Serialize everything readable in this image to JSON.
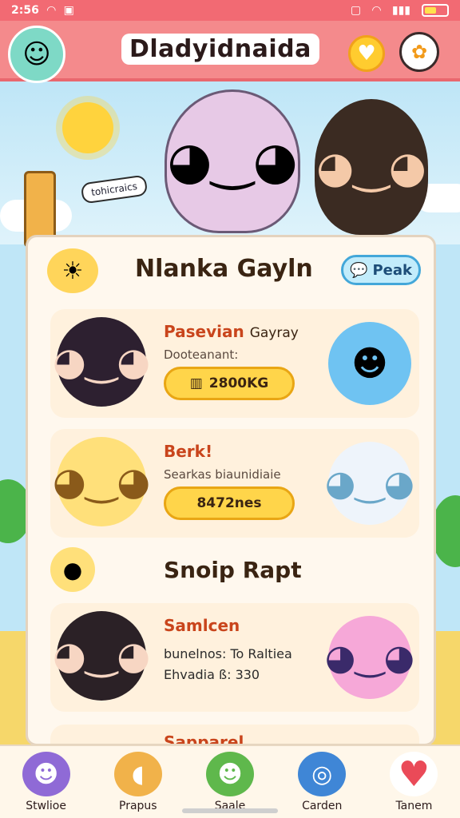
{
  "status": {
    "time": "2:56"
  },
  "header": {
    "title": "Dladyidnaida"
  },
  "hero": {
    "bubble_text": "tohicraics"
  },
  "panel": {
    "title": "Nlanka Gayln",
    "peek_button": "Peak",
    "cards": [
      {
        "name": "Pasevian",
        "name_suffix": "Gayray",
        "subtitle": "Dooteanant:",
        "pill": "2800KG"
      },
      {
        "name": "Berk!",
        "subtitle": "Searkas biaunidiaie",
        "pill": "8472nes"
      }
    ],
    "section_title": "Snoip Rapt",
    "card3": {
      "name": "Samlcen",
      "line1": "bunelnos: To Raltiea",
      "line2": "Ehvadia ß: 330"
    },
    "partial_card_label": "Sapparel"
  },
  "bottom_nav": [
    {
      "label": "Stwlioe",
      "icon": "monster-icon",
      "color": "#8f6ad6"
    },
    {
      "label": "Prapus",
      "icon": "fish-icon",
      "color": "#f1b24a"
    },
    {
      "label": "Saale",
      "icon": "blob-icon",
      "color": "#5fb84c"
    },
    {
      "label": "Carden",
      "icon": "compass-icon",
      "color": "#3f86d6"
    },
    {
      "label": "Tanem",
      "icon": "heart-icon",
      "color": "#ea4a58"
    }
  ]
}
